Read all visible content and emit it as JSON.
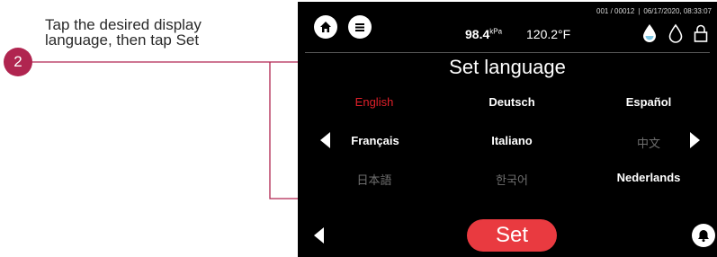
{
  "callout": {
    "step_number": "2",
    "line1": "Tap the desired display",
    "line2": "language, then tap Set"
  },
  "status_bar": {
    "counter": "001 / 00012",
    "datetime": "06/17/2020, 08:33:07",
    "pressure_value": "98.4",
    "pressure_unit": "kPa",
    "temperature": "120.2°F"
  },
  "screen": {
    "title": "Set language",
    "languages": [
      {
        "label": "English",
        "state": "selected"
      },
      {
        "label": "Deutsch",
        "state": "available"
      },
      {
        "label": "Español",
        "state": "available"
      },
      {
        "label": "Français",
        "state": "available"
      },
      {
        "label": "Italiano",
        "state": "available"
      },
      {
        "label": "中文",
        "state": "dim"
      },
      {
        "label": "日本語",
        "state": "dim"
      },
      {
        "label": "한국어",
        "state": "dim"
      },
      {
        "label": "Nederlands",
        "state": "available"
      }
    ],
    "set_label": "Set"
  },
  "icons": {
    "home": "home-icon",
    "menu": "menu-icon",
    "water_filled": "water-drop-filled-icon",
    "water_outline": "water-drop-outline-icon",
    "lock": "lock-icon",
    "prev_page": "arrow-left-icon",
    "next_page": "arrow-right-icon",
    "back": "back-arrow-icon",
    "alarm": "bell-icon"
  },
  "colors": {
    "accent_badge": "#b02550",
    "leader_line": "#b02550",
    "set_button": "#e93a40",
    "selected_language": "#e0202a",
    "screen_bg": "#000000"
  }
}
